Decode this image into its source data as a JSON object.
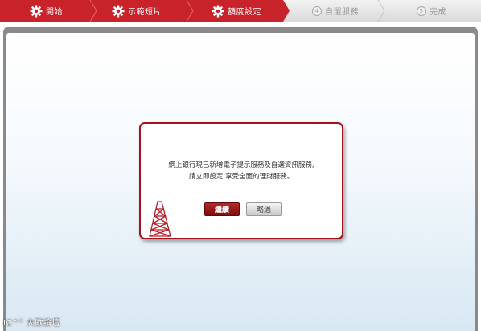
{
  "wizard": {
    "steps": [
      {
        "label": "開始",
        "state": "done"
      },
      {
        "label": "示範短片",
        "state": "done"
      },
      {
        "label": "額度設定",
        "state": "done"
      },
      {
        "number": "4",
        "label": "自選服務",
        "state": "pending"
      },
      {
        "number": "5",
        "label": "完成",
        "state": "pending"
      }
    ]
  },
  "dialog": {
    "line1": "網上銀行現已新增電子提示服務及自選資訊服務,",
    "line2": "請立即設定,享受全面的理財服務。",
    "continue_label": "繼續",
    "skip_label": "略過"
  },
  "watermark": "IC^° 大歐論壇",
  "colors": {
    "brand_red": "#c8222a",
    "dark_red": "#a3121e",
    "pending_gray": "#9a9a9a",
    "frame_gray": "#8a8a8a"
  }
}
